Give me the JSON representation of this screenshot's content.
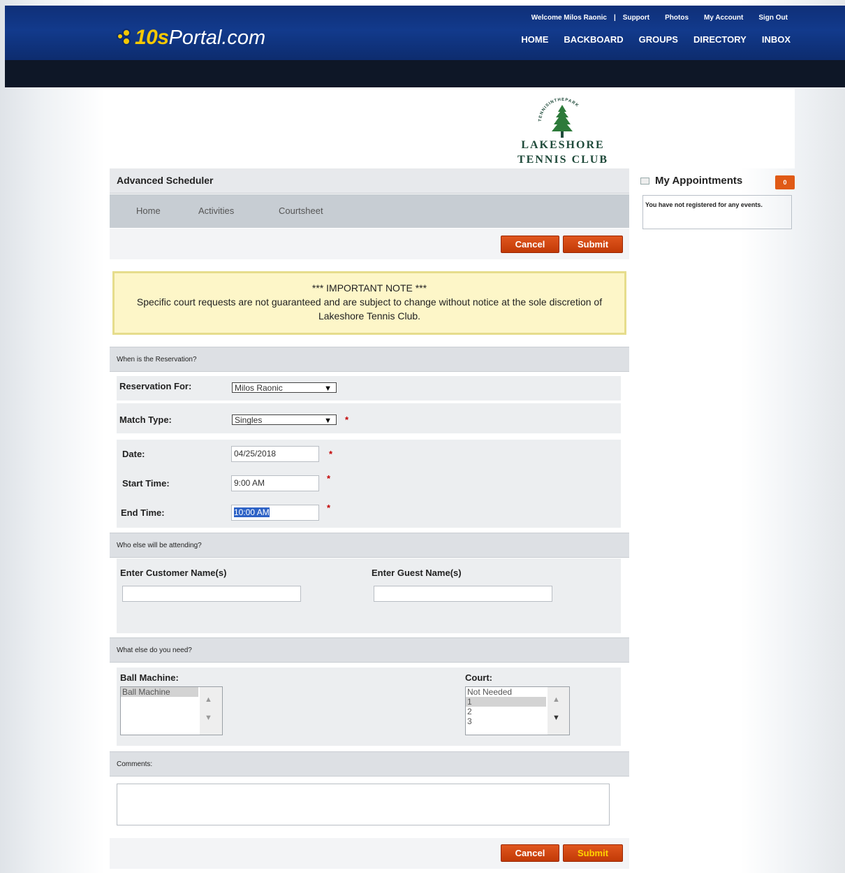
{
  "header": {
    "brand": "10s",
    "brand_suffix": "Portal.com",
    "welcome": "Welcome Milos Raonic",
    "separator": "|",
    "top_links": [
      "Support",
      "Photos",
      "My Account",
      "Sign Out"
    ],
    "nav": [
      "HOME",
      "BACKBOARD",
      "GROUPS",
      "DIRECTORY",
      "INBOX"
    ]
  },
  "club": {
    "arc_text": "TENNISINTHEPARK",
    "name_line1": "Lakeshore",
    "name_line2": "Tennis Club"
  },
  "scheduler": {
    "title": "Advanced Scheduler",
    "tabs": [
      "Home",
      "Activities",
      "Courtsheet"
    ],
    "cancel_label": "Cancel",
    "submit_label": "Submit",
    "note_title": "*** IMPORTANT NOTE ***",
    "note_body": "Specific court requests are not guaranteed and are subject to change without notice at the sole discretion of Lakeshore Tennis Club.",
    "section_when": "When is the Reservation?",
    "reservation_for_label": "Reservation For:",
    "reservation_for_value": "Milos Raonic",
    "match_type_label": "Match Type:",
    "match_type_value": "Singles",
    "required_mark": "*",
    "date_label": "Date:",
    "date_value": "04/25/2018",
    "start_label": "Start Time:",
    "start_value": "9:00 AM",
    "end_label": "End Time:",
    "end_value": "10:00 AM",
    "section_who": "Who else will be attending?",
    "customer_label": "Enter Customer Name(s)",
    "guest_label": "Enter Guest Name(s)",
    "section_what": "What else do you need?",
    "ball_machine_label": "Ball Machine:",
    "ball_machine_options": [
      "Ball Machine"
    ],
    "court_label": "Court:",
    "court_options": [
      "Not Needed",
      "1",
      "2",
      "3"
    ],
    "comments_label": "Comments:"
  },
  "sidebar": {
    "title": "My Appointments",
    "badge": "0",
    "empty_text": "You have not registered for any events."
  },
  "colors": {
    "header_blue": "#123a8c",
    "brand_yellow": "#f6c800",
    "button_orange": "#c23a06",
    "note_bg": "#fdf6c8"
  }
}
